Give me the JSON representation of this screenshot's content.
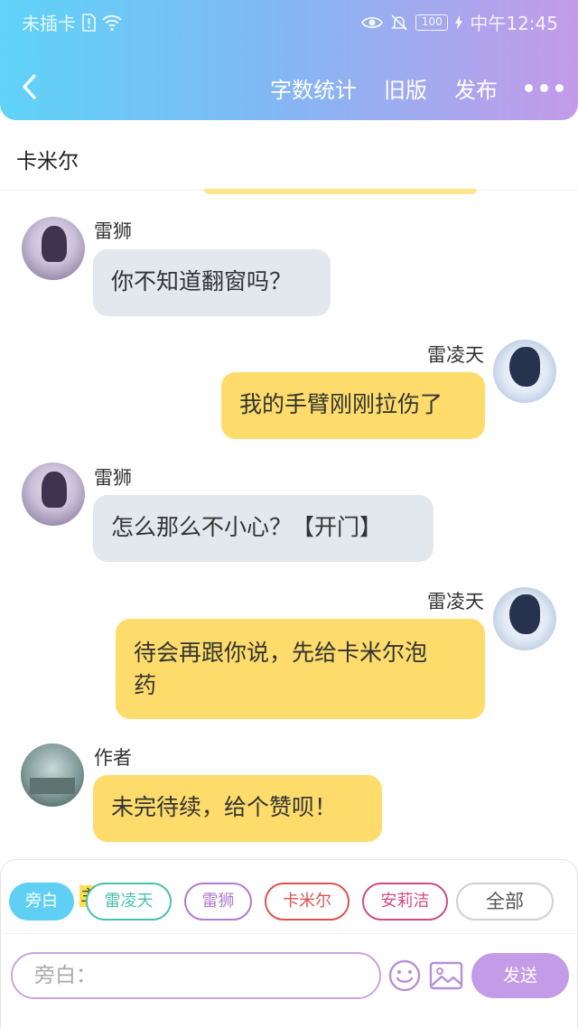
{
  "status_bar": {
    "carrier": "未插卡",
    "battery": "100",
    "time": "中午12:45"
  },
  "nav": {
    "back_icon": "chevron-left-icon",
    "actions": [
      "字数统计",
      "旧版",
      "发布"
    ],
    "more_icon": "more-dots-icon"
  },
  "story": {
    "title": "卡米尔"
  },
  "messages": [
    {
      "side": "left",
      "sender": "雷狮",
      "text": "你不知道翻窗吗？"
    },
    {
      "side": "right",
      "sender": "雷凌天",
      "text": "我的手臂刚刚拉伤了"
    },
    {
      "side": "left",
      "sender": "雷狮",
      "text": "怎么那么不小心？【开门】"
    },
    {
      "side": "right",
      "sender": "雷凌天",
      "text_line1": "待会再跟你说，先给卡米尔泡",
      "text_line2": "药"
    },
    {
      "side": "left",
      "sender": "作者",
      "text": "未完待续，给个赞呗！"
    }
  ],
  "characters": {
    "narration": "旁白",
    "main_tag": "主",
    "items": [
      "雷凌天",
      "雷狮",
      "卡米尔",
      "安莉洁"
    ],
    "all": "全部"
  },
  "composer": {
    "placeholder": "旁白：",
    "value": "",
    "emoji_icon": "smiley-icon",
    "image_icon": "image-icon",
    "send_label": "发送"
  },
  "colors": {
    "header_gradient_start": "#5fd3f7",
    "header_gradient_end": "#c49ae9",
    "left_bubble": "#e3e7ee",
    "right_bubble": "#fddc6b",
    "send_button": "#c49be6"
  }
}
